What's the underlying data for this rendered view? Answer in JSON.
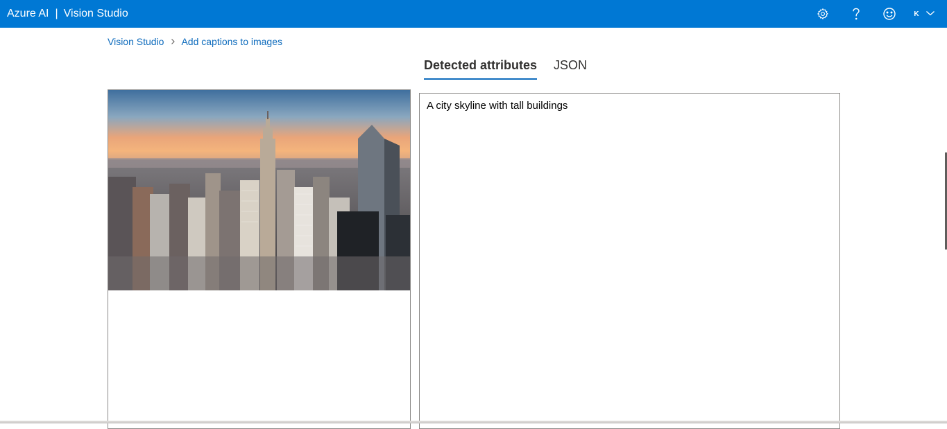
{
  "header": {
    "brand": "Azure AI",
    "separator": "|",
    "product": "Vision Studio",
    "icons": [
      "settings-icon",
      "help-icon",
      "feedback-icon"
    ],
    "account_initial": "K",
    "accent_color": "#0078d4"
  },
  "breadcrumb": {
    "items": [
      "Vision Studio",
      "Add captions to images"
    ]
  },
  "tabs": [
    {
      "label": "Detected attributes",
      "active": true
    },
    {
      "label": "JSON",
      "active": false
    }
  ],
  "result": {
    "caption": "A city skyline with tall buildings"
  },
  "image": {
    "subject": "city skyline photo"
  }
}
